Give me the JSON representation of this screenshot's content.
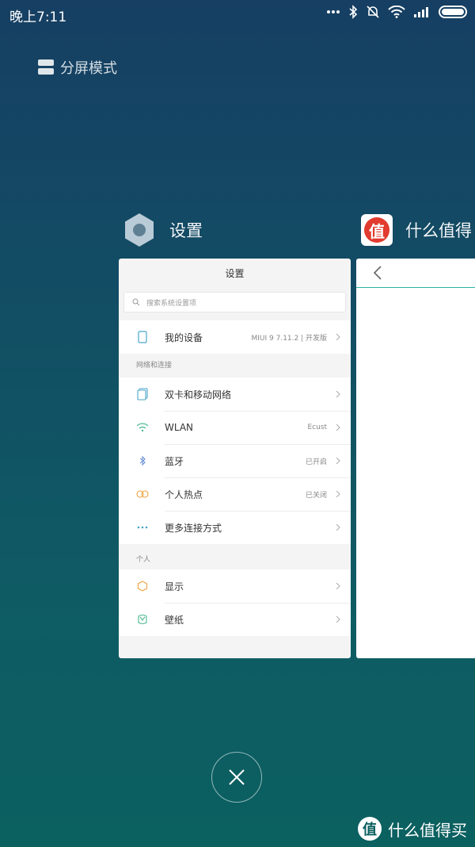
{
  "status_bar": {
    "time": "晚上7:11"
  },
  "split_screen": {
    "label": "分屏模式"
  },
  "apps": [
    {
      "name": "设置"
    },
    {
      "name": "什么值得"
    }
  ],
  "settings_card": {
    "title": "设置",
    "search_placeholder": "搜索系统设置项",
    "device": {
      "label": "我的设备",
      "value": "MIUI 9 7.11.2 | 开发版"
    },
    "network_header": "网络和连接",
    "network_items": [
      {
        "label": "双卡和移动网络",
        "value": ""
      },
      {
        "label": "WLAN",
        "value": "Ecust"
      },
      {
        "label": "蓝牙",
        "value": "已开启"
      },
      {
        "label": "个人热点",
        "value": "已关闭"
      },
      {
        "label": "更多连接方式",
        "value": ""
      }
    ],
    "personal_header": "个人",
    "personal_items": [
      {
        "label": "显示"
      },
      {
        "label": "壁纸"
      }
    ]
  },
  "smzdm_logo_char": "值",
  "watermark": {
    "logo": "值",
    "text": "什么值得买"
  },
  "colors": {
    "accent_teal": "#2bb3a4",
    "zhi_red": "#e23b2f"
  }
}
